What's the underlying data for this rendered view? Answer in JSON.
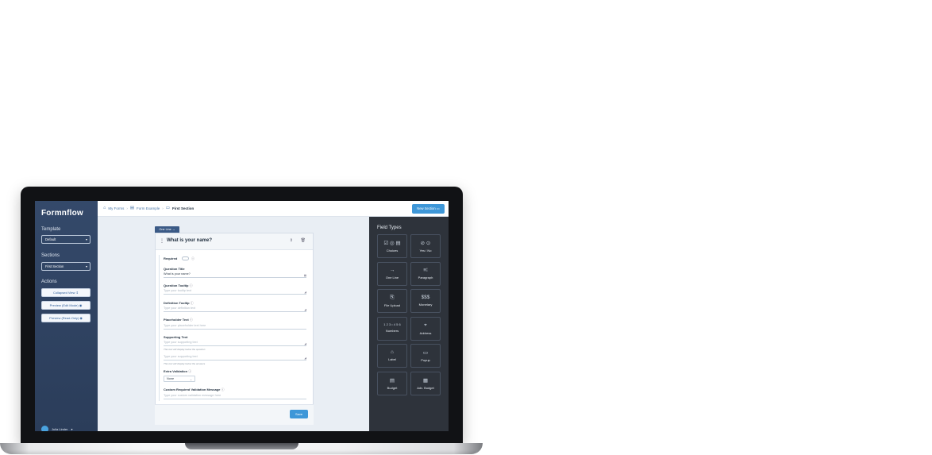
{
  "app": {
    "brand": "Formnflow"
  },
  "sidebar": {
    "template_label": "Template",
    "template_value": "Default",
    "sections_label": "Sections",
    "section_value": "First Section",
    "actions_label": "Actions",
    "actions": [
      "Collapsed View",
      "Preview (Edit Mode)",
      "Preview (Read-Only)"
    ],
    "user_name": "Julia Linder"
  },
  "breadcrumb": {
    "items": [
      "My Forms",
      "Form Example",
      "First Section"
    ]
  },
  "header": {
    "new_section_label": "New Section"
  },
  "question": {
    "type_tag": "One Line",
    "title": "What is your name?",
    "required_label": "Required",
    "question_title_label": "Question Title",
    "question_title_value": "What is your name?",
    "tooltip_label": "Question Tooltip",
    "tooltip_placeholder": "Type your tooltip text",
    "definition_label": "Definition Tooltip",
    "definition_placeholder": "Type your definition text",
    "placeholder_label": "Placeholder Text",
    "placeholder_placeholder": "Type your placeholder text here",
    "supporting_label": "Supporting Text",
    "supporting_placeholder_1": "Type your supporting text",
    "supporting_hint_1": "This text will display below the question",
    "supporting_placeholder_2": "Type your supporting text",
    "supporting_hint_2": "This text will display below the answers",
    "extra_validation_label": "Extra Validation",
    "extra_validation_value": "None",
    "custom_msg_label": "Custom Required Validation Message",
    "custom_msg_placeholder": "Type your custom validation message here",
    "save_label": "Save"
  },
  "field_types": {
    "title": "Field Types",
    "items": [
      {
        "label": "Choices",
        "icon": "choices-icon",
        "glyph": "☑ ◎ ▤"
      },
      {
        "label": "Yes / No",
        "icon": "yes-no-icon",
        "glyph": "⊘ ⊙"
      },
      {
        "label": "One Line",
        "icon": "one-line-icon",
        "glyph": "→"
      },
      {
        "label": "Paragraph",
        "icon": "paragraph-icon",
        "glyph": "≡⁞"
      },
      {
        "label": "File Upload",
        "icon": "file-upload-icon",
        "glyph": "⎘"
      },
      {
        "label": "Monetary",
        "icon": "monetary-icon",
        "glyph": "$$$"
      },
      {
        "label": "Numbers",
        "icon": "numbers-icon",
        "glyph": "1 2 3 • 4 5 6"
      },
      {
        "label": "Address",
        "icon": "address-icon",
        "glyph": "⌖"
      },
      {
        "label": "Label",
        "icon": "label-icon",
        "glyph": "⌂"
      },
      {
        "label": "Popup",
        "icon": "popup-icon",
        "glyph": "▭"
      },
      {
        "label": "Budget",
        "icon": "budget-icon",
        "glyph": "▤"
      },
      {
        "label": "Adv. Budget",
        "icon": "adv-budget-icon",
        "glyph": "▦"
      }
    ]
  }
}
